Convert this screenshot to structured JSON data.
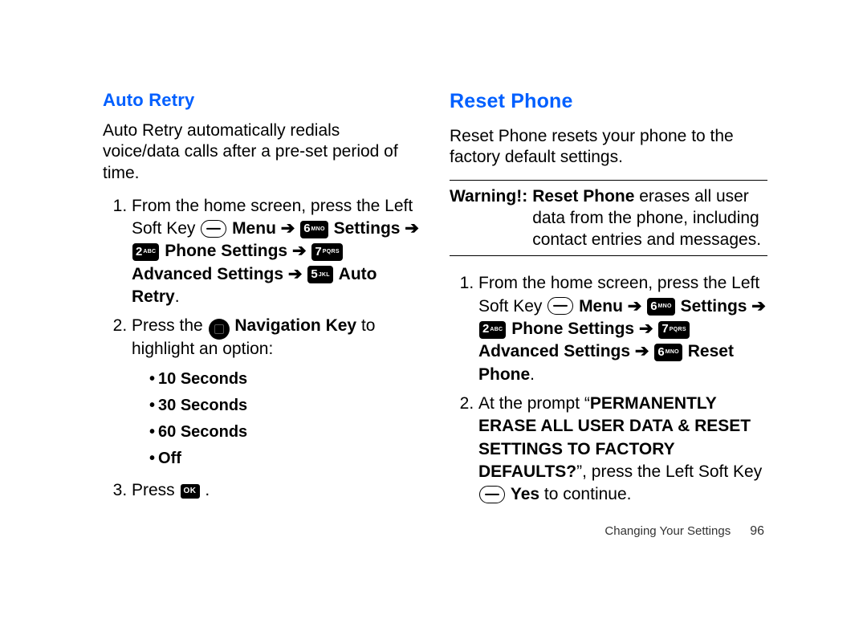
{
  "arrow": "➔",
  "left": {
    "h": "Auto Retry",
    "intro": "Auto Retry automatically redials voice/data calls after a pre-set period of time.",
    "s1a": "From the home screen, press the Left Soft Key ",
    "s1b": "Menu",
    "s1c": "Settings",
    "s1d": "Phone Settings",
    "s1e": "Advanced Settings",
    "s1f": "Auto Retry",
    "s2a": "Press the ",
    "s2b": "Navigation Key",
    "s2c": " to highlight an option:",
    "opts": {
      "a": "10 Seconds",
      "b": "30 Seconds",
      "c": "60 Seconds",
      "d": "Off"
    },
    "s3": "Press ",
    "ok": "OK"
  },
  "right": {
    "h": "Reset Phone",
    "intro": "Reset Phone resets your phone to the factory default settings.",
    "warnLabel": "Warning!:",
    "warn1": "Reset Phone",
    "warn2": " erases all user data from the phone, including contact entries and messages.",
    "s1a": "From the home screen, press the Left Soft Key ",
    "s1b": "Menu",
    "s1c": "Settings",
    "s1d": "Phone Settings",
    "s1e": "Advanced Settings",
    "s1f": "Reset Phone",
    "s2a": "At the prompt “",
    "s2b": "PERMANENTLY ERASE ALL USER DATA & RESET SETTINGS TO FACTORY DEFAULTS?",
    "s2c": "”, press the Left Soft Key ",
    "s2d": "Yes",
    "s2e": " to continue."
  },
  "keys": {
    "k6": {
      "n": "6",
      "s": "MNO"
    },
    "k2": {
      "n": "2",
      "s": "ABC"
    },
    "k7": {
      "n": "7",
      "s": "PQRS"
    },
    "k5": {
      "n": "5",
      "s": "JKL"
    }
  },
  "footer": {
    "section": "Changing Your Settings",
    "page": "96"
  }
}
